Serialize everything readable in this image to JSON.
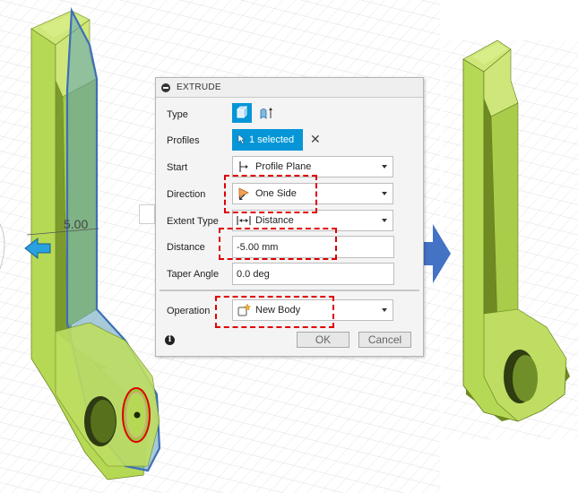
{
  "dimension_label": "5.00",
  "dialog": {
    "title": "EXTRUDE",
    "type": {
      "label": "Type",
      "icons": [
        "solid-extrude-icon",
        "surface-extrude-icon"
      ]
    },
    "profiles": {
      "label": "Profiles",
      "value": "1 selected"
    },
    "start": {
      "label": "Start",
      "value": "Profile Plane"
    },
    "direction": {
      "label": "Direction",
      "value": "One Side"
    },
    "extent_type": {
      "label": "Extent Type",
      "value": "Distance"
    },
    "distance": {
      "label": "Distance",
      "value": "-5.00 mm"
    },
    "taper_angle": {
      "label": "Taper Angle",
      "value": "0.0 deg"
    },
    "operation": {
      "label": "Operation",
      "value": "New Body"
    },
    "ok_label": "OK",
    "cancel_label": "Cancel"
  },
  "colors": {
    "accent": "#0696d7",
    "part_green": "#b6d955",
    "highlight": "#e00000",
    "arrow_blue": "#4472c4"
  }
}
